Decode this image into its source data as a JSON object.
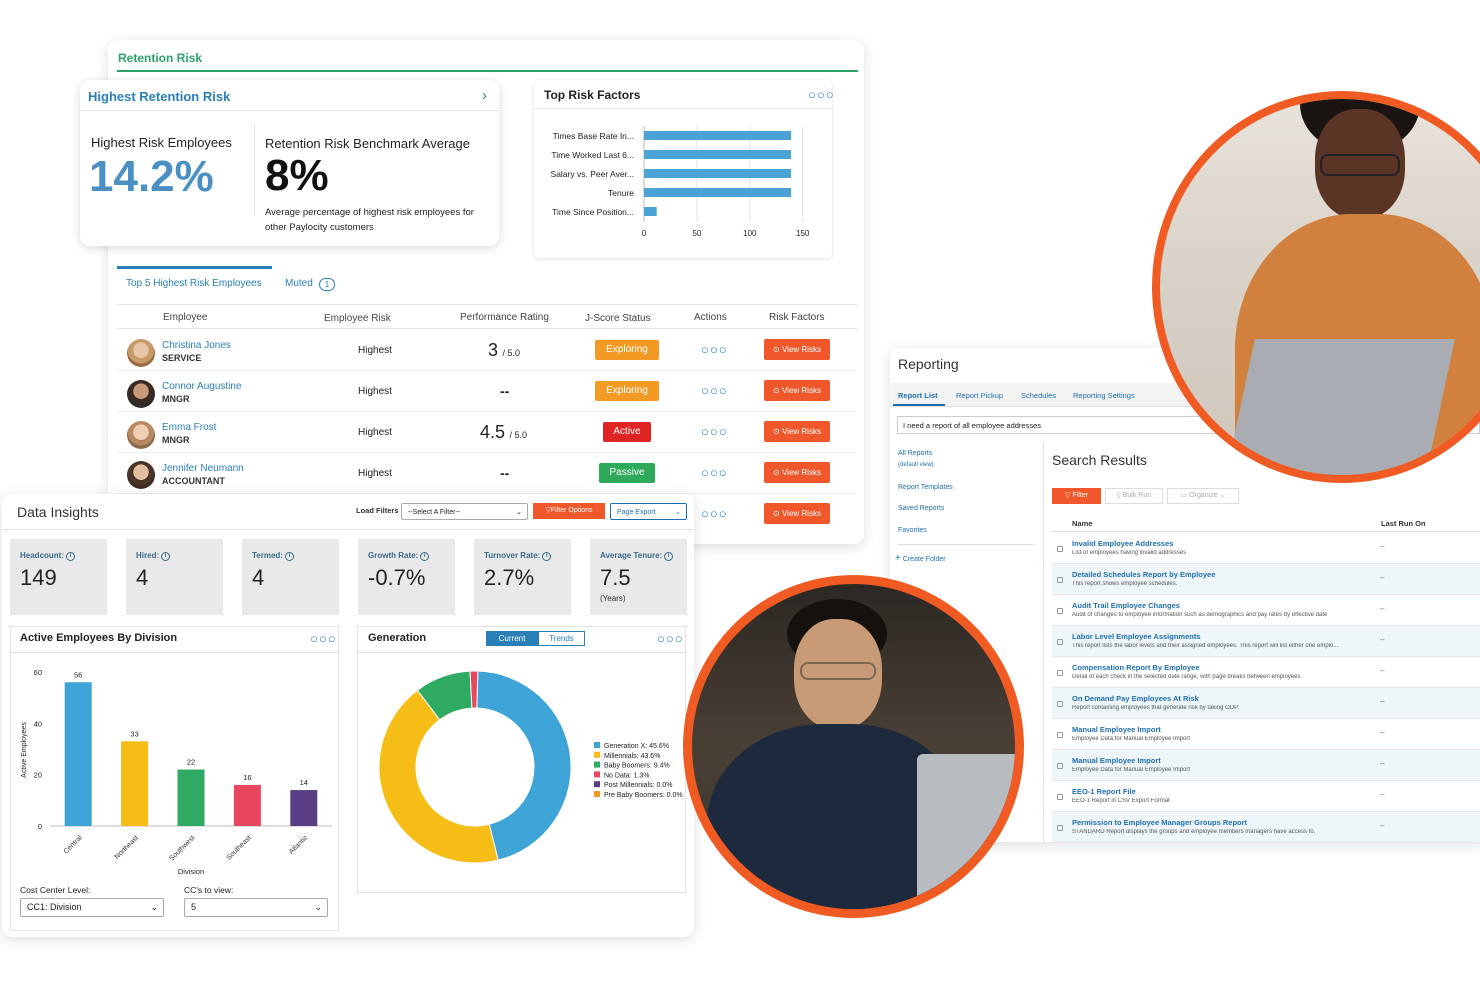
{
  "retention": {
    "section_title": "Retention Risk",
    "card_title": "Highest Retention Risk",
    "employees_label": "Highest Risk Employees",
    "employees_value": "14.2%",
    "benchmark_label": "Retention Risk Benchmark Average",
    "benchmark_value": "8%",
    "benchmark_desc_1": "Average percentage of highest risk employees for",
    "benchmark_desc_2": "other Paylocity customers"
  },
  "top_risk": {
    "title": "Top Risk Factors",
    "chart_data": {
      "type": "bar",
      "orientation": "horizontal",
      "categories": [
        "Times Base Rate In...",
        "Time Worked Last 6...",
        "Salary vs. Peer Aver...",
        "Tenure",
        "Time Since Position..."
      ],
      "values": [
        139,
        139,
        139,
        139,
        12
      ],
      "xticks": [
        "0",
        "50",
        "100",
        "150"
      ],
      "xlim": [
        0,
        155
      ],
      "color": "#4aa3d4"
    }
  },
  "tabs": {
    "top5": "Top 5 Highest Risk Employees",
    "muted": "Muted",
    "muted_count": "1"
  },
  "table": {
    "headers": [
      "Employee",
      "Employee Risk",
      "Performance Rating",
      "J-Score Status",
      "Actions",
      "Risk Factors"
    ],
    "rows": [
      {
        "name": "Christina Jones",
        "role": "SERVICE",
        "risk": "Highest",
        "rating": "3",
        "rating_suffix": "/ 5.0",
        "status": "Exploring",
        "status_color": "#f39a24",
        "view": "⊙ View Risks"
      },
      {
        "name": "Connor Augustine",
        "role": "MNGR",
        "risk": "Highest",
        "rating": "--",
        "rating_suffix": "",
        "status": "Exploring",
        "status_color": "#f39a24",
        "view": "⊙ View Risks"
      },
      {
        "name": "Emma Frost",
        "role": "MNGR",
        "risk": "Highest",
        "rating": "4.5",
        "rating_suffix": "/ 5.0",
        "status": "Active",
        "status_color": "#e02424",
        "view": "⊙ View Risks"
      },
      {
        "name": "Jennifer Neumann",
        "role": "ACCOUNTANT",
        "risk": "Highest",
        "rating": "--",
        "rating_suffix": "",
        "status": "Passive",
        "status_color": "#2eaa5a",
        "view": "⊙ View Risks"
      },
      {
        "name": "",
        "role": "",
        "risk": "",
        "rating": "",
        "rating_suffix": "",
        "status": "",
        "status_color": "",
        "view": "⊙ View Risks"
      }
    ]
  },
  "insights": {
    "title": "Data Insights",
    "load_filters": "Load Filters",
    "select_filter": "--Select A Filter--",
    "filter_options": "Filter Options",
    "page_export": "Page Export",
    "stats": [
      {
        "label": "Headcount:",
        "value": "149",
        "sub": ""
      },
      {
        "label": "Hired:",
        "value": "4",
        "sub": ""
      },
      {
        "label": "Termed:",
        "value": "4",
        "sub": ""
      },
      {
        "label": "Growth Rate:",
        "value": "-0.7%",
        "sub": ""
      },
      {
        "label": "Turnover Rate:",
        "value": "2.7%",
        "sub": ""
      },
      {
        "label": "Average Tenure:",
        "value": "7.5",
        "sub": "(Years)"
      }
    ]
  },
  "division": {
    "title": "Active Employees By Division",
    "cost_center_label": "Cost Center Level:",
    "cost_center_value": "CC1: Division",
    "ccs_label": "CC's to view:",
    "ccs_value": "5",
    "chart_data": {
      "type": "bar",
      "categories": [
        "Central",
        "Northeast",
        "Southwest",
        "Southeast",
        "Atlantic"
      ],
      "values": [
        56,
        33,
        22,
        16,
        14
      ],
      "colors": [
        "#3ea3d6",
        "#f6bd16",
        "#2eaa63",
        "#e8475f",
        "#5a3d82"
      ],
      "yticks": [
        "0",
        "20",
        "40",
        "60"
      ],
      "ylim": [
        0,
        60
      ],
      "ylabel": "Active Employees",
      "xlabel": "Division"
    }
  },
  "generation": {
    "title": "Generation",
    "tab_current": "Current",
    "tab_trends": "Trends",
    "chart_data": {
      "type": "pie",
      "labels": [
        "Generation X: 45.6%",
        "Millennials: 43.6%",
        "Baby Boomers: 9.4%",
        "No Data: 1.3%",
        "Post Millennials: 0.0%",
        "Pre Baby Boomers: 0.0%"
      ],
      "values": [
        45.6,
        43.6,
        9.4,
        1.3,
        0.0,
        0.0
      ],
      "colors": [
        "#3ea3d6",
        "#f6bd16",
        "#2eaa63",
        "#e8475f",
        "#5a3d82",
        "#f39a24"
      ]
    }
  },
  "reporting": {
    "title": "Reporting",
    "tabs": [
      "Report List",
      "Report Pickup",
      "Schedules",
      "Reporting Settings"
    ],
    "search_value": "I need a report of all employee addresses",
    "sidebar": [
      "All Reports",
      "(default view)",
      "Report Templates",
      "Saved Reports",
      "Favorites"
    ],
    "create_folder": "Create Folder",
    "results_title": "Search Results",
    "filter": "Filter",
    "bulk_run": "Bulk Run",
    "organize": "Organize",
    "col_name": "Name",
    "col_last_run": "Last Run On",
    "rows": [
      {
        "name": "Invalid Employee Addresses",
        "desc": "List of employees having invalid addresses",
        "last": "--"
      },
      {
        "name": "Detailed Schedules Report by Employee",
        "desc": "This report shows employee schedules.",
        "last": "--"
      },
      {
        "name": "Audit Trail Employee Changes",
        "desc": "Audit of changes to employee information such as demographics and pay rates by effective date",
        "last": "--"
      },
      {
        "name": "Labor Level Employee Assignments",
        "desc": "This report lists the labor levels and their assigned employees. This report will list either one emplo...",
        "last": "--"
      },
      {
        "name": "Compensation Report By Employee",
        "desc": "Detail of each check in the selected date range, with page breaks between employees",
        "last": "--"
      },
      {
        "name": "On Demand Pay Employees At Risk",
        "desc": "Report containing employees that generate risk by taking ODP.",
        "last": "--"
      },
      {
        "name": "Manual Employee Import",
        "desc": "Employee Data for Manual Employee Import",
        "last": "--"
      },
      {
        "name": "Manual Employee Import",
        "desc": "Employee Data for Manual Employee Import",
        "last": "--"
      },
      {
        "name": "EEO-1 Report File",
        "desc": "EEO-1 Report in CSV Export Format",
        "last": "--"
      },
      {
        "name": "Permission to Employee Manager Groups Report",
        "desc": "STANDARD Report displays the groups and employee members managers have access to.",
        "last": "--"
      }
    ]
  }
}
